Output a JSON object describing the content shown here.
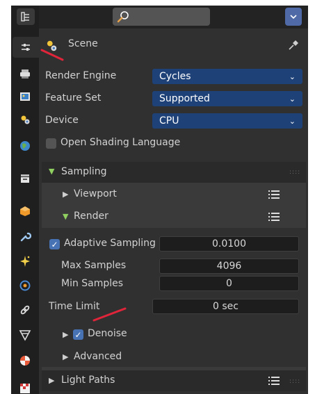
{
  "header": {
    "outliner_icon": "outliner-icon",
    "search_icon": "search-icon",
    "dropdown_icon": "chevron-down-icon"
  },
  "tabs": [
    {
      "name": "tool-tab-icon"
    },
    {
      "name": "render-tab-icon"
    },
    {
      "name": "output-tab-icon"
    },
    {
      "name": "view-layer-tab-icon"
    },
    {
      "name": "scene-tab-icon"
    },
    {
      "name": "world-tab-icon"
    },
    {
      "name": "collection-tab-icon"
    },
    {
      "name": "object-tab-icon"
    },
    {
      "name": "modifier-tab-icon"
    },
    {
      "name": "particles-tab-icon"
    },
    {
      "name": "physics-tab-icon"
    },
    {
      "name": "constraints-tab-icon"
    },
    {
      "name": "data-tab-icon"
    },
    {
      "name": "material-tab-icon"
    },
    {
      "name": "texture-tab-icon"
    }
  ],
  "context": {
    "title": "Scene",
    "pin_icon": "pin-icon"
  },
  "render_engine": {
    "label": "Render Engine",
    "value": "Cycles"
  },
  "feature_set": {
    "label": "Feature Set",
    "value": "Supported"
  },
  "device": {
    "label": "Device",
    "value": "CPU"
  },
  "osl": {
    "label": "Open Shading Language",
    "checked": false
  },
  "sampling": {
    "title": "Sampling",
    "viewport": "Viewport",
    "render": "Render",
    "adaptive": {
      "label": "Adaptive Sampling",
      "checked": true,
      "value": "0.0100"
    },
    "max_samples": {
      "label": "Max Samples",
      "value": "4096"
    },
    "min_samples": {
      "label": "Min Samples",
      "value": "0"
    },
    "time_limit": {
      "label": "Time Limit",
      "value": "0 sec"
    },
    "denoise": {
      "label": "Denoise",
      "checked": true
    },
    "advanced": "Advanced"
  },
  "light_paths": {
    "title": "Light Paths"
  },
  "colors": {
    "dropdown_bg": "#1e4278",
    "checkbox_on": "#4772b3",
    "open_triangle": "#8fd060",
    "annotation": "#e0253a"
  }
}
